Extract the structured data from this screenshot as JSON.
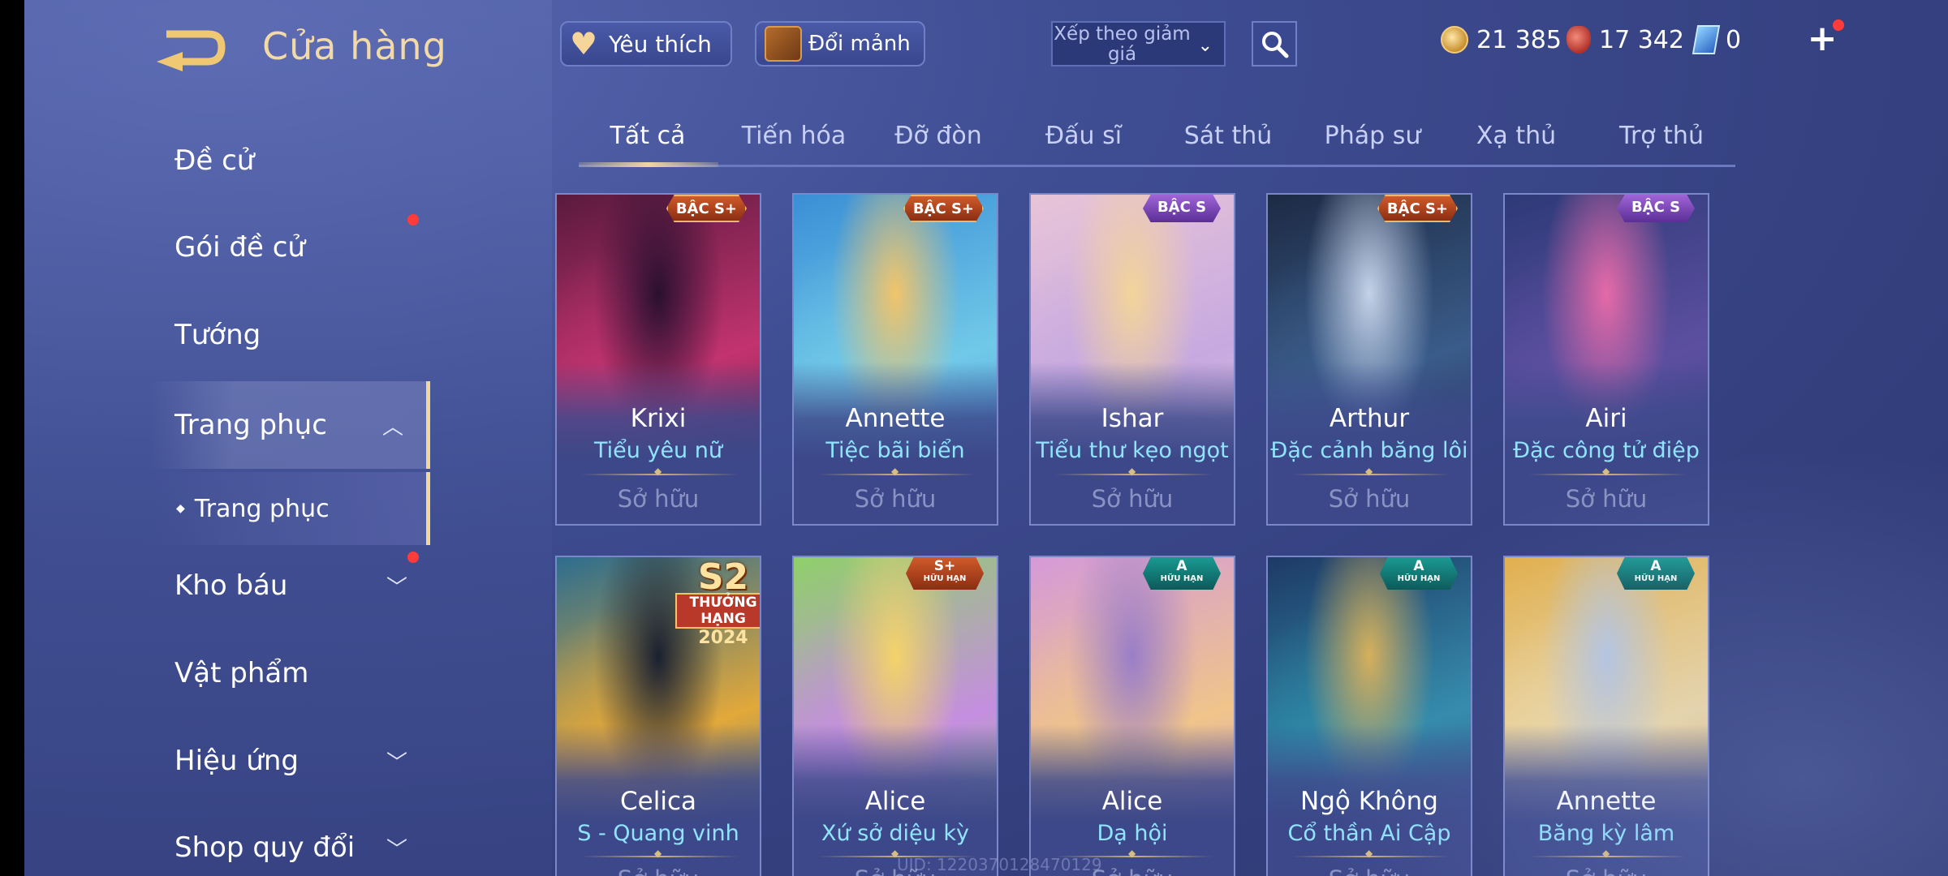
{
  "header": {
    "title": "Cửa hàng",
    "favorites_label": "Yêu thích",
    "shards_label": "Đổi mảnh",
    "sort_label": "Xếp theo giảm giá",
    "currencies": {
      "gold": "21 385",
      "red": "17 342",
      "card": "0"
    }
  },
  "sidebar": {
    "items": [
      {
        "label": "Đề cử"
      },
      {
        "label": "Gói đề cử"
      },
      {
        "label": "Tướng"
      },
      {
        "label": "Trang phục"
      },
      {
        "label": "Trang phục"
      },
      {
        "label": "Kho báu"
      },
      {
        "label": "Vật phẩm"
      },
      {
        "label": "Hiệu ứng"
      },
      {
        "label": "Shop quy đổi"
      }
    ]
  },
  "tabs": [
    "Tất cả",
    "Tiến hóa",
    "Đỡ đòn",
    "Đấu sĩ",
    "Sát thủ",
    "Pháp sư",
    "Xạ thủ",
    "Trợ thủ"
  ],
  "cards": [
    {
      "hero": "Krixi",
      "skin": "Tiểu yêu nữ",
      "status": "Sở hữu",
      "badge": "BẬC S+",
      "colors": [
        "#5a1a3e",
        "#c2336f",
        "#2a1030"
      ]
    },
    {
      "hero": "Annette",
      "skin": "Tiệc bãi biển",
      "status": "Sở hữu",
      "badge": "BẬC S+",
      "colors": [
        "#3a8fd6",
        "#71c9e8",
        "#f1c46a"
      ]
    },
    {
      "hero": "Ishar",
      "skin": "Tiểu thư kẹo ngọt",
      "status": "Sở hữu",
      "badge": "BẬC S",
      "colors": [
        "#e8c4d8",
        "#c7a9e0",
        "#f3d49a"
      ]
    },
    {
      "hero": "Arthur",
      "skin": "Đặc cảnh băng lôi",
      "status": "Sở hữu",
      "badge": "BẬC S+",
      "colors": [
        "#1d2a44",
        "#3a5c8a",
        "#c4d2e8"
      ]
    },
    {
      "hero": "Airi",
      "skin": "Đặc công tử điệp",
      "status": "Sở hữu",
      "badge": "BẬC S",
      "colors": [
        "#2d3a78",
        "#5d4fa0",
        "#e56aa8"
      ]
    },
    {
      "hero": "Celica",
      "skin": "S - Quang vinh",
      "status": "Sở hữu",
      "badge": "",
      "season": {
        "big": "S2",
        "mid": "THƯỞNG HẠNG",
        "yr": "2024"
      },
      "colors": [
        "#2c6d8e",
        "#e2a83a",
        "#1a2030"
      ]
    },
    {
      "hero": "Alice",
      "skin": "Xứ sở diệu kỳ",
      "status": "Sở hữu",
      "badge": "S+",
      "badge_sub": "HỮU HẠN",
      "colors": [
        "#8fd06a",
        "#c58ee0",
        "#f4d36a"
      ]
    },
    {
      "hero": "Alice",
      "skin": "Dạ hội",
      "status": "Sở hữu",
      "badge": "A",
      "badge_sub": "HỮU HẠN",
      "colors": [
        "#d49ad8",
        "#f0c48a",
        "#9a7ec8"
      ]
    },
    {
      "hero": "Ngộ Không",
      "skin": "Cổ thần Ai Cập",
      "status": "Sở hữu",
      "badge": "A",
      "badge_sub": "HỮU HẠN",
      "colors": [
        "#1e3a66",
        "#2f8aa8",
        "#d6b05a"
      ]
    },
    {
      "hero": "Annette",
      "skin": "Băng kỳ lâm",
      "status": "Sở hữu",
      "badge": "A",
      "badge_sub": "HỮU HẠN",
      "colors": [
        "#e3b04a",
        "#f4dca0",
        "#b8c8e0"
      ]
    }
  ],
  "footer": {
    "uid": "UID: 1220370128470129"
  }
}
